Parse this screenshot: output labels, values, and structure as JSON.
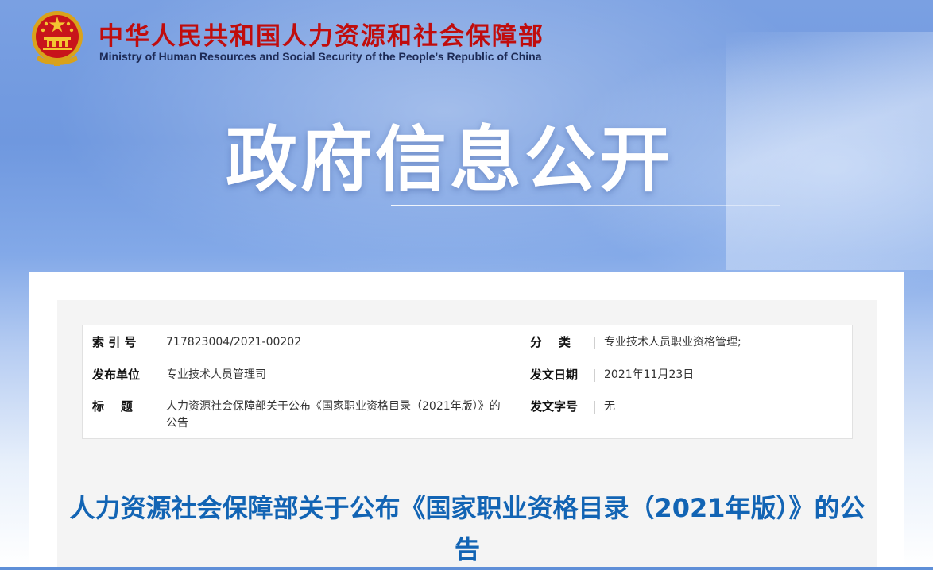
{
  "header": {
    "org_name_cn": "中华人民共和国人力资源和社会保障部",
    "org_name_en": "Ministry of Human Resources and Social Security of the People’s Republic of China",
    "section_title": "政府信息公开"
  },
  "meta": {
    "index_label": "索 引 号",
    "index_value": "717823004/2021-00202",
    "category_label": "分    类",
    "category_value": "专业技术人员职业资格管理;",
    "publisher_label": "发布单位",
    "publisher_value": "专业技术人员管理司",
    "date_label": "发文日期",
    "date_value": "2021年11月23日",
    "title_label": "标    题",
    "title_value": "人力资源社会保障部关于公布《国家职业资格目录（2021年版）》的公告",
    "docno_label": "发文字号",
    "docno_value": "无"
  },
  "document": {
    "title": "人力资源社会保障部关于公布《国家职业资格目录（2021年版）》的公告"
  },
  "colors": {
    "brand_red": "#c00d0d",
    "title_blue": "#1264b4"
  },
  "icons": {
    "emblem": "national-emblem-icon"
  }
}
